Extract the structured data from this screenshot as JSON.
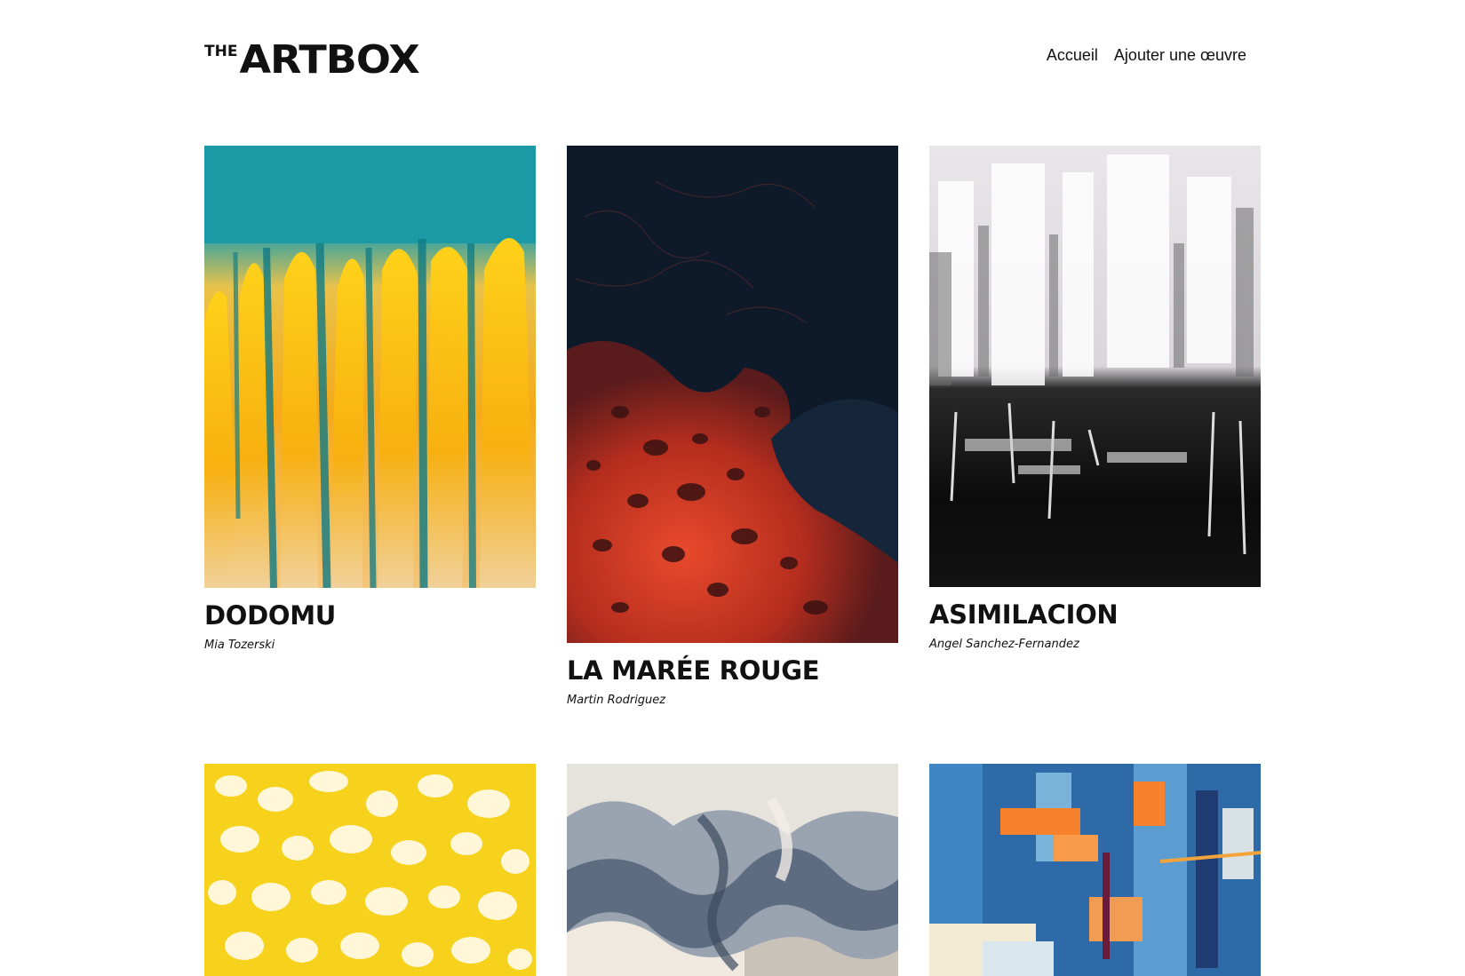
{
  "header": {
    "logo_small": "THE",
    "logo_main": "ARTBOX",
    "nav": [
      {
        "label": "Accueil"
      },
      {
        "label": "Ajouter une œuvre"
      }
    ]
  },
  "artworks": [
    {
      "title": "DODOMU",
      "artist": "Mia Tozerski"
    },
    {
      "title": "LA MARÉE ROUGE",
      "artist": "Martin Rodriguez"
    },
    {
      "title": "ASIMILACION",
      "artist": "Angel Sanchez-Fernandez"
    },
    {
      "title": "",
      "artist": ""
    },
    {
      "title": "",
      "artist": ""
    },
    {
      "title": "",
      "artist": ""
    }
  ]
}
